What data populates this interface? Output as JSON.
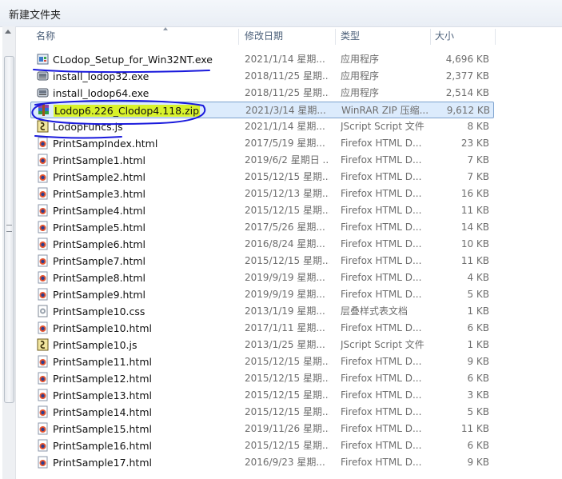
{
  "window": {
    "title": "新建文件夹"
  },
  "columns": {
    "name": "名称",
    "date": "修改日期",
    "type": "类型",
    "size": "大小"
  },
  "files": [
    {
      "name": "CLodop_Setup_for_Win32NT.exe",
      "date": "2021/1/14 星期...",
      "type": "应用程序",
      "size": "4,696 KB",
      "icon": "setup-exe-icon"
    },
    {
      "name": "install_lodop32.exe",
      "date": "2018/11/25 星期...",
      "type": "应用程序",
      "size": "2,377 KB",
      "icon": "installer-icon"
    },
    {
      "name": "install_lodop64.exe",
      "date": "2018/11/25 星期...",
      "type": "应用程序",
      "size": "2,514 KB",
      "icon": "installer-icon"
    },
    {
      "name": "Lodop6.226_Clodop4.118.zip",
      "date": "2021/3/14 星期...",
      "type": "WinRAR ZIP 压缩...",
      "size": "9,612 KB",
      "icon": "winrar-icon",
      "selected": true
    },
    {
      "name": "LodopFuncs.js",
      "date": "2021/1/14 星期...",
      "type": "JScript Script 文件",
      "size": "8 KB",
      "icon": "jscript-icon"
    },
    {
      "name": "PrintSampIndex.html",
      "date": "2017/5/19 星期...",
      "type": "Firefox HTML D...",
      "size": "23 KB",
      "icon": "firefox-html-icon"
    },
    {
      "name": "PrintSample1.html",
      "date": "2019/6/2 星期日 ...",
      "type": "Firefox HTML D...",
      "size": "7 KB",
      "icon": "firefox-html-icon"
    },
    {
      "name": "PrintSample2.html",
      "date": "2015/12/15 星期...",
      "type": "Firefox HTML D...",
      "size": "7 KB",
      "icon": "firefox-html-icon"
    },
    {
      "name": "PrintSample3.html",
      "date": "2015/12/13 星期...",
      "type": "Firefox HTML D...",
      "size": "16 KB",
      "icon": "firefox-html-icon"
    },
    {
      "name": "PrintSample4.html",
      "date": "2015/12/15 星期...",
      "type": "Firefox HTML D...",
      "size": "11 KB",
      "icon": "firefox-html-icon"
    },
    {
      "name": "PrintSample5.html",
      "date": "2017/5/26 星期...",
      "type": "Firefox HTML D...",
      "size": "14 KB",
      "icon": "firefox-html-icon"
    },
    {
      "name": "PrintSample6.html",
      "date": "2016/8/24 星期...",
      "type": "Firefox HTML D...",
      "size": "10 KB",
      "icon": "firefox-html-icon"
    },
    {
      "name": "PrintSample7.html",
      "date": "2015/12/15 星期...",
      "type": "Firefox HTML D...",
      "size": "11 KB",
      "icon": "firefox-html-icon"
    },
    {
      "name": "PrintSample8.html",
      "date": "2019/9/19 星期...",
      "type": "Firefox HTML D...",
      "size": "4 KB",
      "icon": "firefox-html-icon"
    },
    {
      "name": "PrintSample9.html",
      "date": "2019/9/19 星期...",
      "type": "Firefox HTML D...",
      "size": "5 KB",
      "icon": "firefox-html-icon"
    },
    {
      "name": "PrintSample10.css",
      "date": "2013/1/19 星期...",
      "type": "层叠样式表文档",
      "size": "1 KB",
      "icon": "css-icon"
    },
    {
      "name": "PrintSample10.html",
      "date": "2017/1/11 星期...",
      "type": "Firefox HTML D...",
      "size": "6 KB",
      "icon": "firefox-html-icon"
    },
    {
      "name": "PrintSample10.js",
      "date": "2013/1/25 星期...",
      "type": "JScript Script 文件",
      "size": "1 KB",
      "icon": "jscript-icon"
    },
    {
      "name": "PrintSample11.html",
      "date": "2015/12/15 星期...",
      "type": "Firefox HTML D...",
      "size": "9 KB",
      "icon": "firefox-html-icon"
    },
    {
      "name": "PrintSample12.html",
      "date": "2015/12/15 星期...",
      "type": "Firefox HTML D...",
      "size": "6 KB",
      "icon": "firefox-html-icon"
    },
    {
      "name": "PrintSample13.html",
      "date": "2015/12/15 星期...",
      "type": "Firefox HTML D...",
      "size": "3 KB",
      "icon": "firefox-html-icon"
    },
    {
      "name": "PrintSample14.html",
      "date": "2015/12/15 星期...",
      "type": "Firefox HTML D...",
      "size": "5 KB",
      "icon": "firefox-html-icon"
    },
    {
      "name": "PrintSample15.html",
      "date": "2019/11/26 星期...",
      "type": "Firefox HTML D...",
      "size": "11 KB",
      "icon": "firefox-html-icon"
    },
    {
      "name": "PrintSample16.html",
      "date": "2015/12/15 星期...",
      "type": "Firefox HTML D...",
      "size": "6 KB",
      "icon": "firefox-html-icon"
    },
    {
      "name": "PrintSample17.html",
      "date": "2016/9/23 星期...",
      "type": "Firefox HTML D...",
      "size": "9 KB",
      "icon": "firefox-html-icon"
    }
  ],
  "annotations": {
    "ink_color": "#1a1adc",
    "highlight_color": "#d8f22b"
  }
}
